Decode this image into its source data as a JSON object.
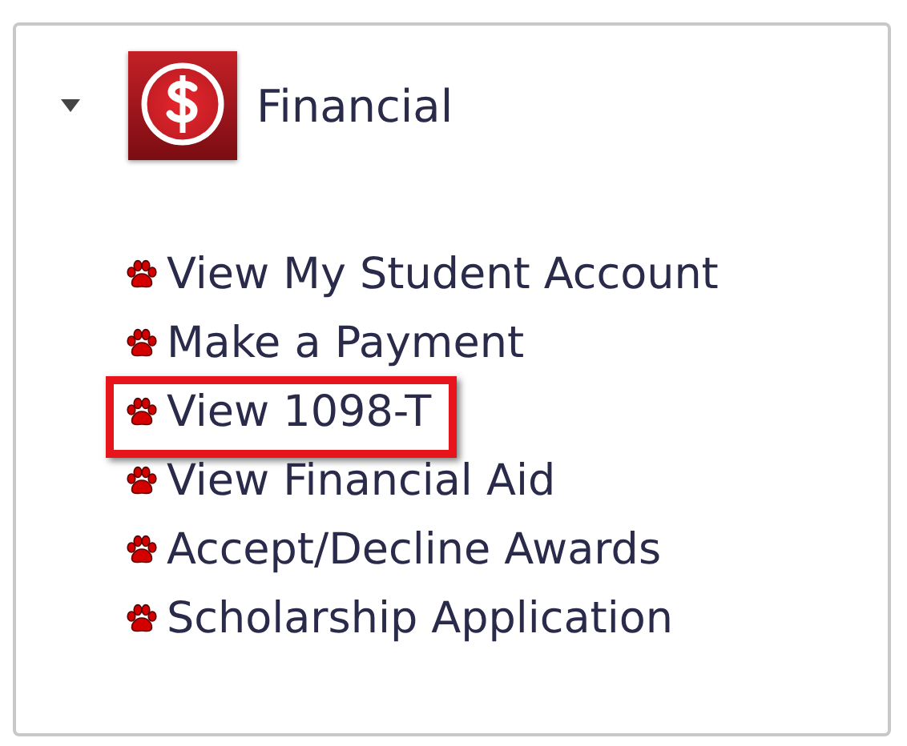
{
  "section": {
    "title": "Financial",
    "expanded": true
  },
  "links": [
    {
      "label": "View My Student Account",
      "highlighted": false
    },
    {
      "label": "Make a Payment",
      "highlighted": false
    },
    {
      "label": "View 1098-T",
      "highlighted": true
    },
    {
      "label": "View Financial Aid",
      "highlighted": false
    },
    {
      "label": "Accept/Decline Awards",
      "highlighted": false
    },
    {
      "label": "Scholarship Application",
      "highlighted": false
    }
  ]
}
